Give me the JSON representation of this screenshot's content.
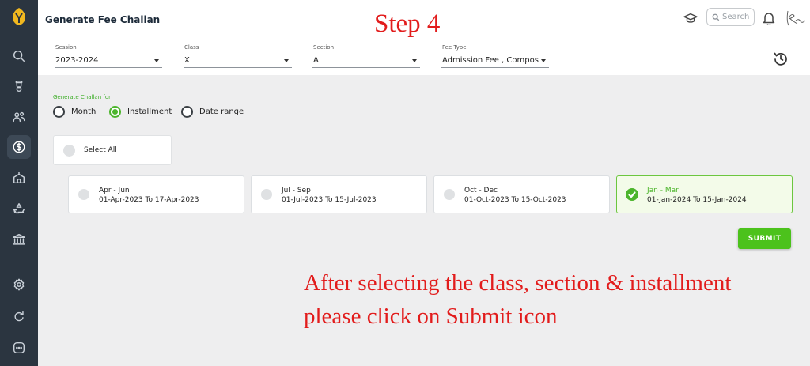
{
  "sidebar": {
    "icons": [
      "app-logo",
      "search-icon",
      "trophy-icon",
      "users-icon",
      "dollar-icon",
      "school-icon",
      "recycle-icon",
      "bank-icon",
      "settings-icon",
      "refresh-icon",
      "more-icon"
    ],
    "active": "dollar-icon"
  },
  "header": {
    "title": "Generate Fee Challan",
    "step_overlay": "Step 4",
    "search_placeholder": "Search"
  },
  "filters": {
    "session": {
      "label": "Session",
      "value": "2023-2024"
    },
    "class": {
      "label": "Class",
      "value": "X"
    },
    "section": {
      "label": "Section",
      "value": "A"
    },
    "fee_type": {
      "label": "Fee Type",
      "value": "Admission Fee , Composit..."
    }
  },
  "generate_for": {
    "label": "Generate Challan for",
    "options": [
      "Month",
      "Installment",
      "Date range"
    ],
    "selected": "Installment"
  },
  "select_all_label": "Select All",
  "installments": [
    {
      "period": "Apr - Jun",
      "range": "01-Apr-2023 To 17-Apr-2023",
      "selected": false
    },
    {
      "period": "Jul - Sep",
      "range": "01-Jul-2023 To 15-Jul-2023",
      "selected": false
    },
    {
      "period": "Oct - Dec",
      "range": "01-Oct-2023 To 15-Oct-2023",
      "selected": false
    },
    {
      "period": "Jan - Mar",
      "range": "01-Jan-2024 To 15-Jan-2024",
      "selected": true
    }
  ],
  "submit_label": "SUBMIT",
  "annotation": {
    "line1": "After selecting the class, section & installment",
    "line2": "please click on Submit icon"
  },
  "colors": {
    "accent_green": "#4cb52c",
    "sidebar_bg": "#2b3540",
    "annotation_red": "#e21c1c"
  }
}
